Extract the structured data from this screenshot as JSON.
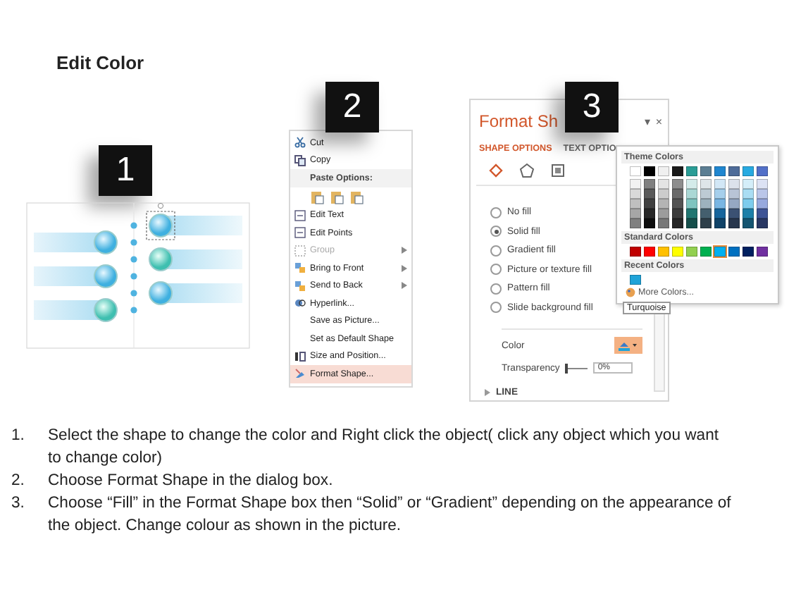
{
  "title": "Edit Color",
  "diagram": {
    "badge": "1"
  },
  "context_menu": {
    "badge": "2",
    "items": [
      {
        "kind": "item",
        "label": "Cut",
        "disabled": false,
        "submenu": false,
        "selected": false
      },
      {
        "kind": "item",
        "label": "Copy",
        "disabled": false,
        "submenu": false,
        "selected": false
      },
      {
        "kind": "header",
        "label": "Paste Options:"
      },
      {
        "kind": "paste-icons"
      },
      {
        "kind": "item",
        "label": "Edit Text",
        "disabled": false,
        "submenu": false,
        "selected": false
      },
      {
        "kind": "item",
        "label": "Edit Points",
        "disabled": false,
        "submenu": false,
        "selected": false
      },
      {
        "kind": "item",
        "label": "Group",
        "disabled": true,
        "submenu": true,
        "selected": false
      },
      {
        "kind": "item",
        "label": "Bring to Front",
        "disabled": false,
        "submenu": true,
        "selected": false
      },
      {
        "kind": "item",
        "label": "Send to Back",
        "disabled": false,
        "submenu": true,
        "selected": false
      },
      {
        "kind": "item",
        "label": "Hyperlink...",
        "disabled": false,
        "submenu": false,
        "selected": false
      },
      {
        "kind": "item",
        "label": "Save as Picture...",
        "disabled": false,
        "submenu": false,
        "selected": false
      },
      {
        "kind": "item",
        "label": "Set as Default Shape",
        "disabled": false,
        "submenu": false,
        "selected": false
      },
      {
        "kind": "item",
        "label": "Size and Position...",
        "disabled": false,
        "submenu": false,
        "selected": false
      },
      {
        "kind": "item",
        "label": "Format Shape...",
        "disabled": false,
        "submenu": false,
        "selected": true
      }
    ]
  },
  "format_pane": {
    "badge": "3",
    "title": "Format Sh",
    "menu": "▾",
    "close": "×",
    "tabs": [
      {
        "label": "SHAPE OPTIONS",
        "selected": true
      },
      {
        "label": "TEXT OPTIO",
        "selected": false
      }
    ],
    "icon_tabs": [
      {
        "selected": true
      },
      {
        "selected": false
      },
      {
        "selected": false
      }
    ],
    "fill_options": [
      {
        "label": "No fill",
        "selected": false
      },
      {
        "label": "Solid fill",
        "selected": true
      },
      {
        "label": "Gradient fill",
        "selected": false
      },
      {
        "label": "Picture or texture fill",
        "selected": false
      },
      {
        "label": "Pattern fill",
        "selected": false
      },
      {
        "label": "Slide background fill",
        "selected": false
      }
    ],
    "color_label": "Color",
    "transparency": {
      "label": "Transparency",
      "level": 0,
      "value": "0%"
    },
    "line_label": "LINE"
  },
  "color_popup": {
    "theme_title": "Theme Colors",
    "theme": [
      {
        "color": "#ffffff"
      },
      {
        "color": "#000000"
      },
      {
        "color": "#f0f0f0"
      },
      {
        "color": "#1a1a1a"
      },
      {
        "color": "#2a9d96"
      },
      {
        "color": "#5b7e93"
      },
      {
        "color": "#1f86d0"
      },
      {
        "color": "#4e6c99"
      },
      {
        "color": "#27aae1"
      },
      {
        "color": "#5270c8"
      }
    ],
    "standard_title": "Standard Colors",
    "standard": [
      {
        "color": "#c00000",
        "selected": false
      },
      {
        "color": "#ff0000",
        "selected": false
      },
      {
        "color": "#ffc000",
        "selected": false
      },
      {
        "color": "#ffff00",
        "selected": false
      },
      {
        "color": "#92d050",
        "selected": false
      },
      {
        "color": "#00b050",
        "selected": false
      },
      {
        "color": "#00b0f0",
        "selected": true
      },
      {
        "color": "#0070c0",
        "selected": false
      },
      {
        "color": "#002060",
        "selected": false
      },
      {
        "color": "#7030a0",
        "selected": false
      }
    ],
    "recent_title": "Recent Colors",
    "recent": [
      {
        "color": "#1fa3d8"
      }
    ],
    "more": "More Colors...",
    "tooltip": "Turquoise"
  },
  "steps": [
    {
      "number": "1.",
      "text": "Select the shape to change the color and Right click the object( click any object which you want to change color)"
    },
    {
      "number": "2.",
      "text": "Choose Format Shape in the dialog box."
    },
    {
      "number": "3.",
      "text": "Choose “Fill” in the Format Shape box then “Solid” or “Gradient” depending on the appearance of the object. Change colour as shown in the picture."
    }
  ]
}
